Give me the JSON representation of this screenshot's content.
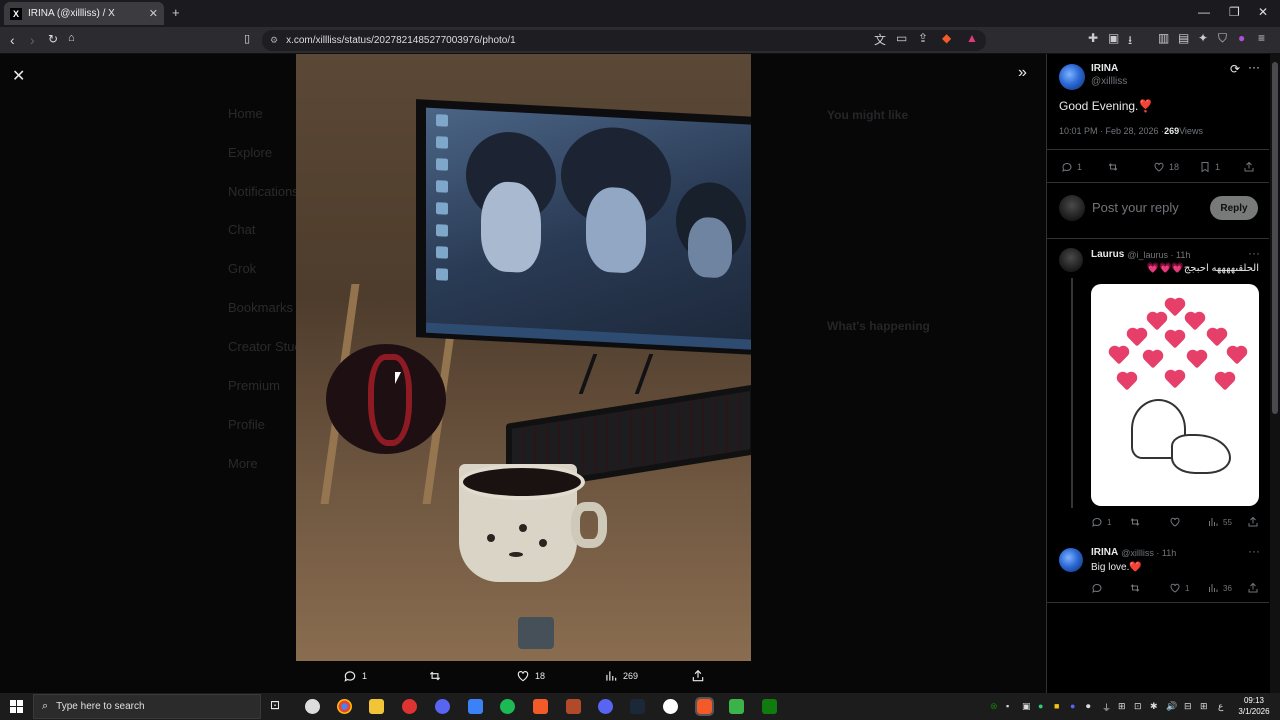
{
  "browser": {
    "tab_title": "IRINA (@xillliss) / X",
    "tab_close": "✕",
    "new_tab": "+",
    "url": "x.com/xillliss/status/2027821485277003976/photo/1",
    "window_min": "—",
    "window_restore": "❐",
    "window_close": "✕"
  },
  "background_page": {
    "nav": [
      "Home",
      "Explore",
      "Notifications",
      "Chat",
      "Grok",
      "Bookmarks",
      "Creator Studio",
      "Premium",
      "Profile",
      "More"
    ],
    "right_headers": [
      "You might like",
      "What's happening"
    ]
  },
  "photo_actions": {
    "replies": "1",
    "likes": "18",
    "views": "269"
  },
  "tweet": {
    "name": "IRINA",
    "handle": "@xillliss",
    "text": "Good Evening.❣️",
    "time": "10:01 PM · Feb 28, 2026 · ",
    "views_count": "269",
    "views_label": " Views",
    "replies": "1",
    "likes": "18",
    "bookmarks": "1",
    "reply_placeholder": "Post your reply",
    "reply_button": "Reply"
  },
  "replies": [
    {
      "name": "Laurus",
      "handle": "@i_laurus · 11h",
      "text": "الحلقىههههه احبجج💗💗💗",
      "replies": "1",
      "views": "55"
    },
    {
      "name": "IRINA",
      "handle": "@xillliss · 11h",
      "text": "Big love.❤️",
      "likes": "1",
      "views": "36"
    }
  ],
  "taskbar": {
    "search_placeholder": "Type here to search",
    "time": "09:13",
    "date": "3/1/2026",
    "lang": "ع"
  },
  "colors": {
    "accent": "#1d9bf0",
    "panel_bg": "#000000",
    "muted": "#71767b"
  }
}
